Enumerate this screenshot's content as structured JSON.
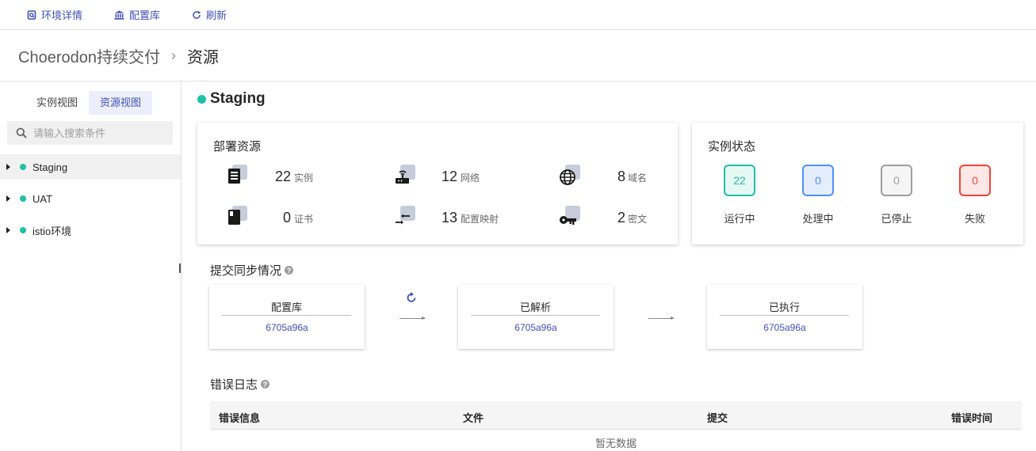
{
  "toolbar": {
    "env_details": "环境详情",
    "config_repo": "配置库",
    "refresh": "刷新"
  },
  "breadcrumb": {
    "app": "Choerodon持续交付",
    "separator": "›",
    "current": "资源"
  },
  "sidebar": {
    "tabs": [
      {
        "label": "实例视图",
        "active": false
      },
      {
        "label": "资源视图",
        "active": true
      }
    ],
    "search_placeholder": "请输入搜索条件",
    "environments": [
      {
        "name": "Staging",
        "status_color": "#1fc1a5",
        "selected": true
      },
      {
        "name": "UAT",
        "status_color": "#1fc1a5",
        "selected": false
      },
      {
        "name": "istio环境",
        "status_color": "#1fc1a5",
        "selected": false
      }
    ]
  },
  "environment": {
    "name": "Staging",
    "status_color": "#1fc1a5"
  },
  "resources": {
    "title": "部署资源",
    "items": [
      {
        "icon": "instance-icon",
        "count": "22",
        "label": "实例"
      },
      {
        "icon": "network-icon",
        "count": "12",
        "label": "网络"
      },
      {
        "icon": "domain-icon",
        "count": "8",
        "label": "域名"
      },
      {
        "icon": "certificate-icon",
        "count": "0",
        "label": "证书"
      },
      {
        "icon": "config-map-icon",
        "count": "13",
        "label": "配置映射"
      },
      {
        "icon": "secret-key-icon",
        "count": "2",
        "label": "密文"
      }
    ]
  },
  "instance_status": {
    "title": "实例状态",
    "items": [
      {
        "value": "22",
        "label": "运行中",
        "color": "#1fc1a5",
        "bg": "#e6f8f4"
      },
      {
        "value": "0",
        "label": "处理中",
        "color": "#4d90fe",
        "bg": "#e3edfd"
      },
      {
        "value": "0",
        "label": "已停止",
        "color": "#9e9e9e",
        "bg": "#f5f5f5"
      },
      {
        "value": "0",
        "label": "失败",
        "color": "#f44336",
        "bg": "#fde8e7"
      }
    ]
  },
  "sync": {
    "title": "提交同步情况",
    "stages": [
      {
        "label": "配置库",
        "commit": "6705a96a"
      },
      {
        "label": "已解析",
        "commit": "6705a96a"
      },
      {
        "label": "已执行",
        "commit": "6705a96a"
      }
    ]
  },
  "error_log": {
    "title": "错误日志",
    "columns": [
      "错误信息",
      "文件",
      "提交",
      "错误时间"
    ],
    "empty_text": "暂无数据"
  },
  "colors": {
    "primary": "#3f51b5",
    "success": "#1fc1a5"
  }
}
